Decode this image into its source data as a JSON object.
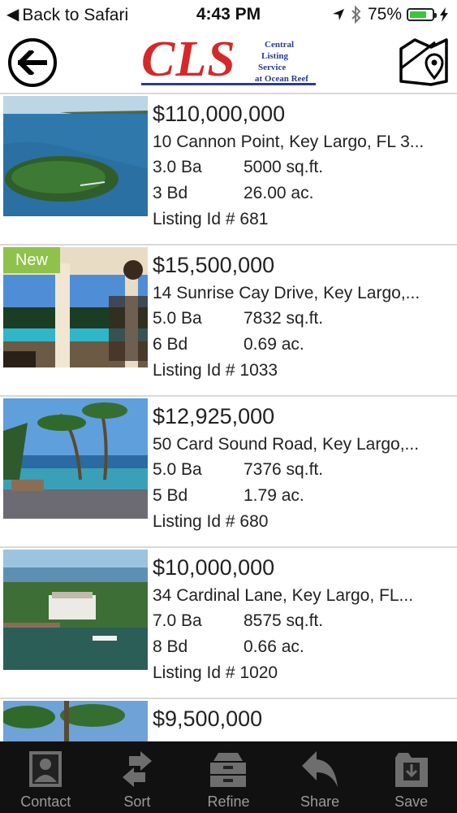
{
  "status_bar": {
    "back_label": "Back to Safari",
    "time": "4:43 PM",
    "battery": "75%",
    "battery_level": 0.75,
    "battery_color": "#38c738"
  },
  "header": {
    "logo_main": "CLS",
    "logo_line1": "Central",
    "logo_line2": "Listing",
    "logo_line3": "Service",
    "logo_line4": "at Ocean Reef",
    "back_icon": "back-arrow-icon",
    "map_icon": "map-pin-icon"
  },
  "listings": [
    {
      "price": "$110,000,000",
      "address": "10 Cannon Point, Key Largo, FL 3...",
      "baths": "3.0 Ba",
      "sqft": "5000 sq.ft.",
      "beds": "3 Bd",
      "acres": "26.00 ac.",
      "listing_id": "Listing Id # 681",
      "badge": ""
    },
    {
      "price": "$15,500,000",
      "address": "14 Sunrise Cay Drive, Key Largo,...",
      "baths": "5.0 Ba",
      "sqft": "7832 sq.ft.",
      "beds": "6 Bd",
      "acres": "0.69 ac.",
      "listing_id": "Listing Id # 1033",
      "badge": "New"
    },
    {
      "price": "$12,925,000",
      "address": "50 Card Sound Road, Key Largo,...",
      "baths": "5.0 Ba",
      "sqft": "7376 sq.ft.",
      "beds": "5 Bd",
      "acres": "1.79 ac.",
      "listing_id": "Listing Id # 680",
      "badge": ""
    },
    {
      "price": "$10,000,000",
      "address": "34 Cardinal Lane, Key Largo, FL...",
      "baths": "7.0 Ba",
      "sqft": "8575 sq.ft.",
      "beds": "8 Bd",
      "acres": "0.66 ac.",
      "listing_id": "Listing Id # 1020",
      "badge": ""
    },
    {
      "price": "$9,500,000"
    }
  ],
  "tabbar": {
    "items": [
      {
        "label": "Contact",
        "icon": "contact-card-icon"
      },
      {
        "label": "Sort",
        "icon": "sort-arrows-icon"
      },
      {
        "label": "Refine",
        "icon": "refine-filter-icon"
      },
      {
        "label": "Share",
        "icon": "share-reply-icon"
      },
      {
        "label": "Save",
        "icon": "save-folder-icon"
      }
    ]
  }
}
